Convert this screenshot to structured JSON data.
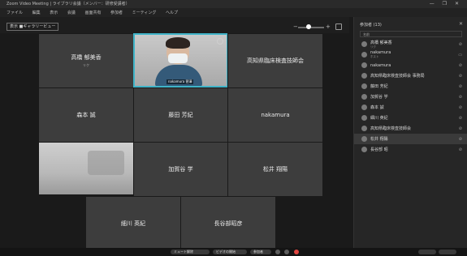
{
  "window": {
    "title": "Zoom Video Meeting | ライブラリ会議（メンバー：研修受講者）",
    "controls": "— ❐ ✕"
  },
  "menu": {
    "items": [
      "ファイル",
      "編集",
      "表示",
      "会議",
      "画面共有",
      "参加者",
      "ミーティング",
      "ヘルプ"
    ]
  },
  "toolbar": {
    "view_button": "表示 ■ギャラリービュー",
    "slider_minus": "−",
    "slider_plus": "+"
  },
  "gallery": {
    "tiles": [
      {
        "name": "高橋 郁美香",
        "sub": "リク"
      },
      {
        "name": "",
        "label": "nakamura 菅澤"
      },
      {
        "name": "高知県臨床検査技師会"
      },
      {
        "name": "森本 誠"
      },
      {
        "name": "藤田 芳紀"
      },
      {
        "name": "nakamura"
      },
      {
        "name": ""
      },
      {
        "name": "加賀谷 学"
      },
      {
        "name": "松井 翔陽"
      },
      {
        "name": "細川 英紀"
      },
      {
        "name": "長谷部昭彦"
      }
    ]
  },
  "bottombar": {
    "buttons": [
      "ミュート解除",
      "ビデオの開始",
      "参加者"
    ]
  },
  "panel": {
    "title": "参加者 (13)",
    "close": "✕",
    "search_placeholder": "名前",
    "participants": [
      {
        "name": "高橋 郁美香",
        "sub": "リク"
      },
      {
        "name": "nakamura",
        "sub": "ホスト"
      },
      {
        "name": "nakamura"
      },
      {
        "name": "高知県臨床検査技師会 事務局"
      },
      {
        "name": "藤田 芳紀"
      },
      {
        "name": "加賀谷 学"
      },
      {
        "name": "森本 誠"
      },
      {
        "name": "細川 英紀"
      },
      {
        "name": "高知県臨床検査技師会"
      },
      {
        "name": "松井 翔陽"
      },
      {
        "name": "長谷部 昭"
      }
    ]
  }
}
